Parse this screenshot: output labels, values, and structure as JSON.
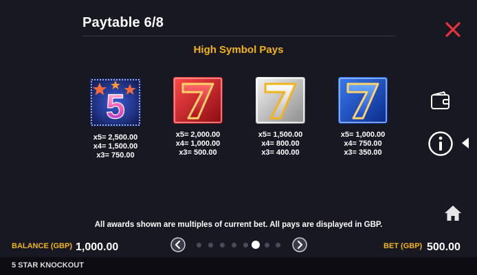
{
  "header": {
    "title": "Paytable 6/8",
    "section_title": "High Symbol Pays"
  },
  "symbols": [
    {
      "name": "5 star",
      "pays": [
        "x5= 2,500.00",
        "x4= 1,500.00",
        "x3= 750.00"
      ]
    },
    {
      "name": "red 7",
      "pays": [
        "x5= 2,000.00",
        "x4= 1,000.00",
        "x3= 500.00"
      ]
    },
    {
      "name": "silver 7",
      "pays": [
        "x5= 1,500.00",
        "x4= 800.00",
        "x3= 400.00"
      ]
    },
    {
      "name": "blue 7",
      "pays": [
        "x5= 1,000.00",
        "x4= 750.00",
        "x3= 350.00"
      ]
    }
  ],
  "footer_note": "All awards shown are multiples of current bet. All pays are displayed in GBP.",
  "balance": {
    "label": "BALANCE (GBP)",
    "value": "1,000.00"
  },
  "bet": {
    "label": "BET (GBP)",
    "value": "500.00"
  },
  "pagination": {
    "current": 6,
    "total": 8
  },
  "game_name": "5 STAR KNOCKOUT",
  "icons": [
    "close-icon",
    "wallet-icon",
    "info-icon",
    "collapse-arrow-icon",
    "home-icon",
    "chevron-left-icon",
    "chevron-right-icon"
  ],
  "colors": {
    "background": "#181822",
    "accent_gold": "#f2b418",
    "close_red": "#e8323c",
    "bottom_bar": "#0c0c12"
  }
}
